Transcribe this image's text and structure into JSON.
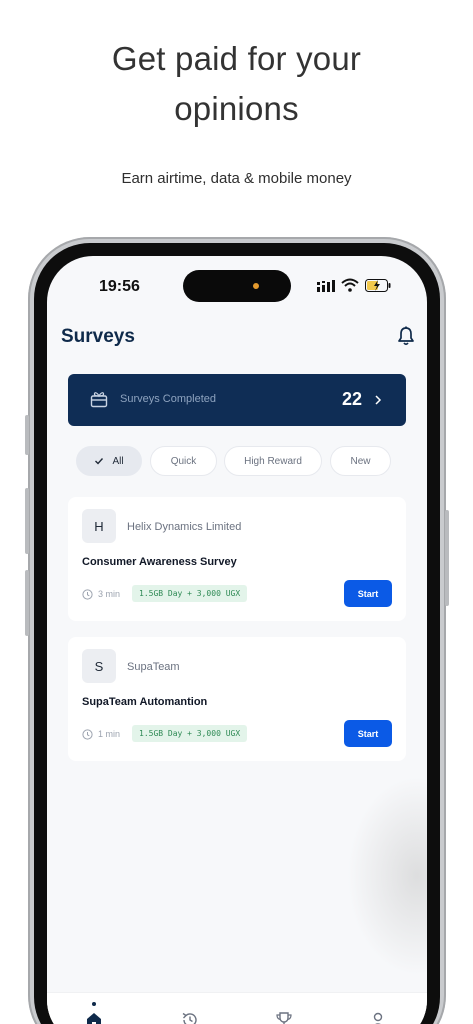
{
  "promo": {
    "title_line1": "Get paid for your",
    "title_line2": "opinions",
    "subtitle": "Earn airtime, data & mobile money"
  },
  "status_bar": {
    "time": "19:56",
    "icons": [
      "signal-icon",
      "wifi-icon",
      "battery-charging-icon"
    ]
  },
  "header": {
    "title": "Surveys",
    "icon": "bell-icon"
  },
  "completed_banner": {
    "icon": "gift-box-icon",
    "label": "Surveys Completed",
    "count": "22"
  },
  "filters": [
    {
      "label": "All",
      "active": true
    },
    {
      "label": "Quick",
      "active": false
    },
    {
      "label": "High Reward",
      "active": false
    },
    {
      "label": "New",
      "active": false
    }
  ],
  "surveys": [
    {
      "initial": "H",
      "company": "Helix Dynamics Limited",
      "title": "Consumer Awareness Survey",
      "duration": "3 min",
      "reward": "1.5GB Day + 3,000 UGX",
      "action": "Start"
    },
    {
      "initial": "S",
      "company": "SupaTeam",
      "title": "SupaTeam Automantion",
      "duration": "1 min",
      "reward": "1.5GB Day + 3,000 UGX",
      "action": "Start"
    }
  ],
  "bottom_nav": [
    {
      "icon": "home-icon",
      "active": true
    },
    {
      "icon": "history-icon",
      "active": false
    },
    {
      "icon": "trophy-icon",
      "active": false
    },
    {
      "icon": "profile-icon",
      "active": false
    }
  ],
  "colors": {
    "primary_navy": "#0f2d55",
    "accent_blue": "#0b5ae6",
    "reward_green": "#2f8a55"
  }
}
